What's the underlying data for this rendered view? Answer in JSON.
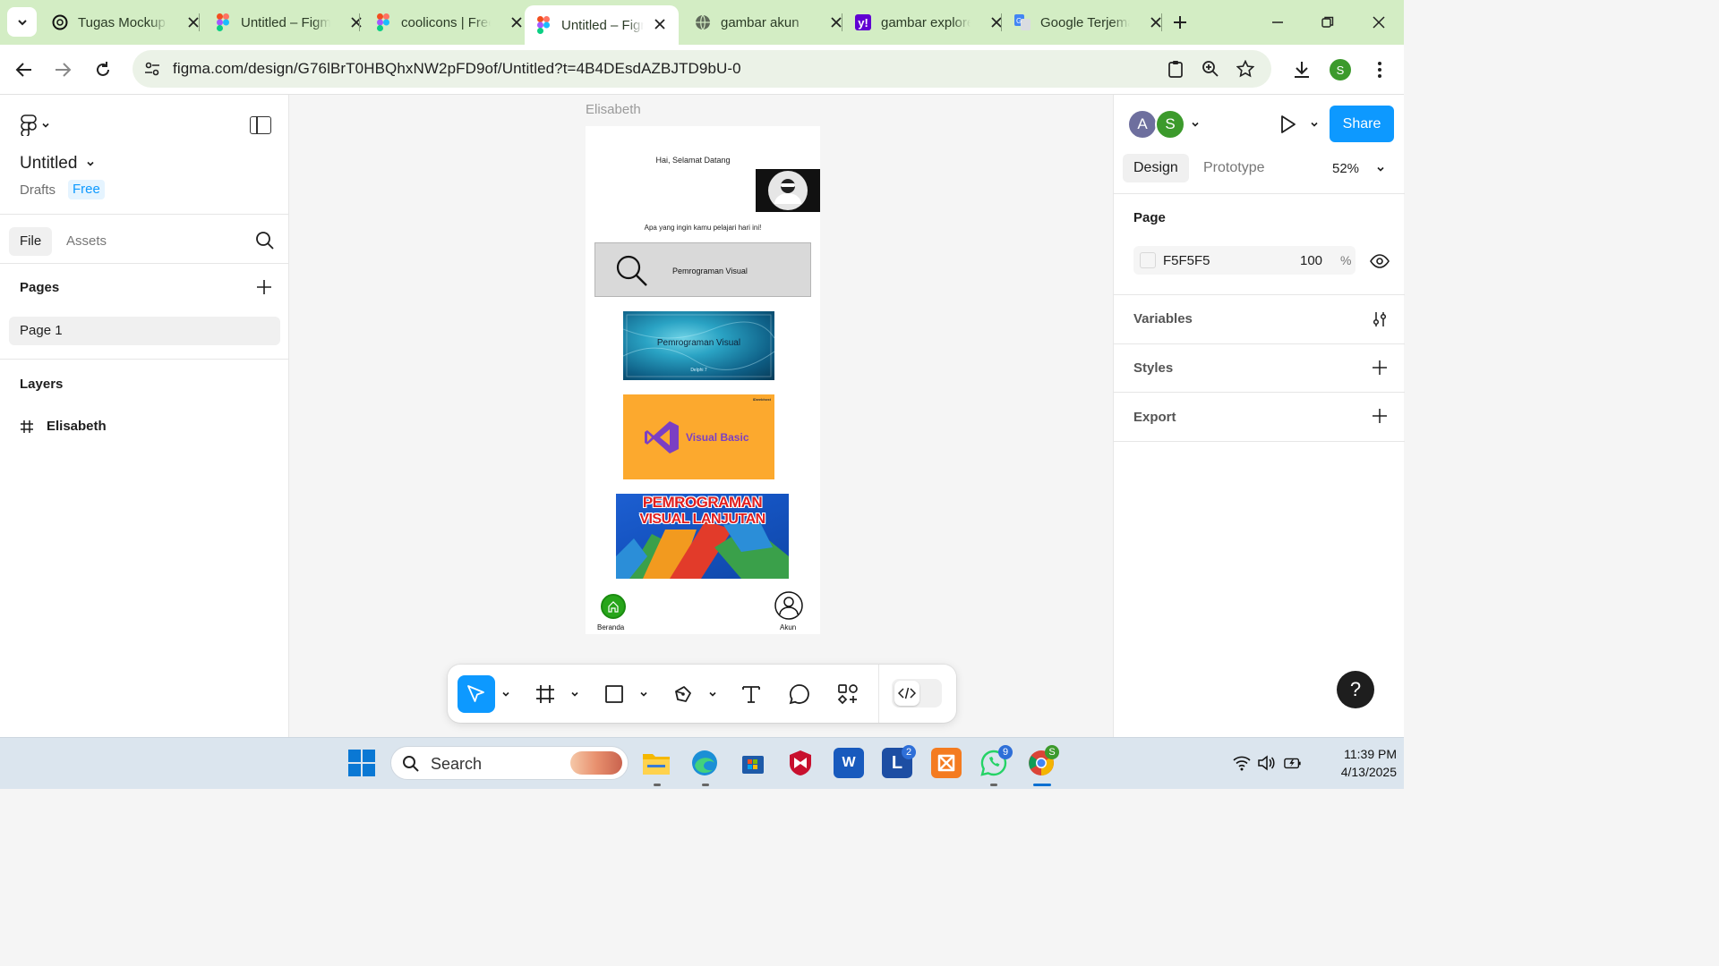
{
  "browser": {
    "tabs": [
      {
        "title": "Tugas Mockup",
        "icon": "openai-icon",
        "active": false
      },
      {
        "title": "Untitled – Figma",
        "icon": "figma-icon",
        "active": false
      },
      {
        "title": "coolicons | Free",
        "icon": "figma-icon",
        "active": false
      },
      {
        "title": "Untitled – Figma",
        "icon": "figma-icon",
        "active": true
      },
      {
        "title": "gambar akun",
        "icon": "globe-icon",
        "active": false
      },
      {
        "title": "gambar explore",
        "icon": "yahoo-icon",
        "active": false
      },
      {
        "title": "Google Terjemahan",
        "icon": "google-translate-icon",
        "active": false
      }
    ],
    "url": "figma.com/design/G76lBrT0HBQhxNW2pFD9of/Untitled?t=4B4DEsdAZBJTD9bU-0",
    "profile_initial": "S"
  },
  "figma": {
    "file": {
      "name": "Untitled",
      "location": "Drafts",
      "plan": "Free"
    },
    "left_tabs": {
      "file": "File",
      "assets": "Assets"
    },
    "pages_heading": "Pages",
    "pages": [
      "Page 1"
    ],
    "layers_heading": "Layers",
    "layers": [
      "Elisabeth"
    ],
    "right": {
      "avatars": [
        "A",
        "S"
      ],
      "share_label": "Share",
      "tabs": {
        "design": "Design",
        "prototype": "Prototype"
      },
      "zoom": "52%",
      "page_heading": "Page",
      "page_color_hex": "F5F5F5",
      "page_opacity": "100",
      "page_opacity_unit": "%",
      "variables": "Variables",
      "styles": "Styles",
      "export": "Export"
    },
    "help_label": "?"
  },
  "frame": {
    "name": "Elisabeth",
    "greeting": "Hai, Selamat Datang",
    "question": "Apa yang ingin kamu pelajari hari ini!",
    "search_query": "Pemrograman Visual",
    "card1_title": "Pemrograman Visual",
    "card1_sub": "Delphi 7",
    "card2_brand": "IDwebhost",
    "card2_title": "Visual Basic",
    "card3_line1": "PEMROGRAMAN",
    "card3_line2": "VISUAL LANJUTAN",
    "nav_home": "Beranda",
    "nav_account": "Akun"
  },
  "taskbar": {
    "search_placeholder": "Search",
    "apps": [
      "file-explorer",
      "edge",
      "microsoft-store",
      "mcafee",
      "word",
      "lightshot",
      "xampp",
      "whatsapp",
      "chrome"
    ],
    "badges": {
      "lightshot": "2",
      "whatsapp": "9",
      "chrome_profile": "S"
    },
    "time": "11:39 PM",
    "date": "4/13/2025"
  },
  "colors": {
    "tab_strip": "#d3edc4",
    "figma_blue": "#0d99ff",
    "canvas": "#f5f5f5"
  }
}
